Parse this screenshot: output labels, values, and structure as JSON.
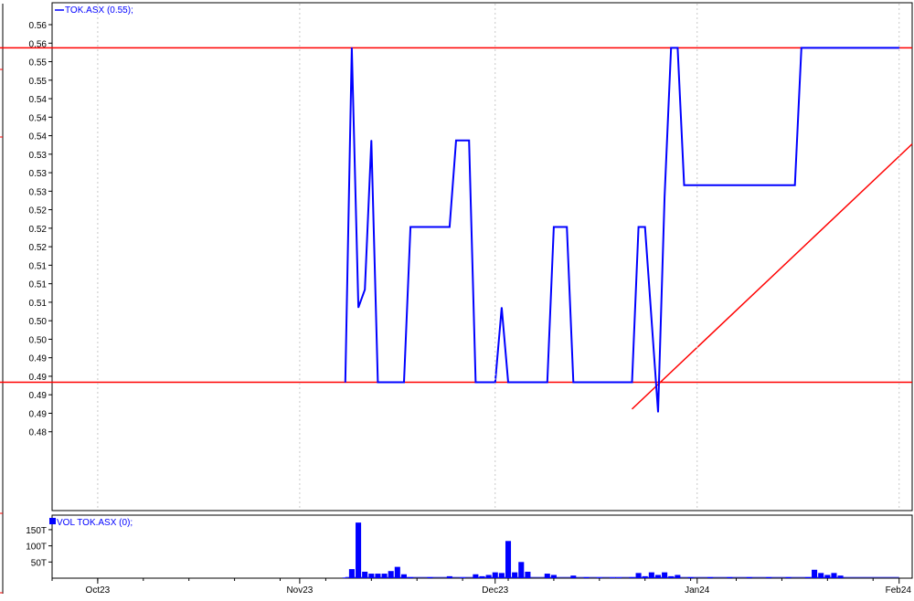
{
  "chart_data": [
    {
      "type": "line",
      "legend": "TOK.ASX (0.55);",
      "legend_position": "top-left",
      "y_tick_labels": [
        "0.56",
        "0.56",
        "0.55",
        "0.55",
        "0.54",
        "0.54",
        "0.54",
        "0.53",
        "0.53",
        "0.53",
        "0.52",
        "0.52",
        "0.52",
        "0.51",
        "0.51",
        "0.51",
        "0.50",
        "0.50",
        "0.49",
        "0.49",
        "0.49",
        "0.49",
        "0.48"
      ],
      "ylim": [
        0.4765,
        0.5614
      ],
      "x_tick_labels": [
        "Oct23",
        "Nov23",
        "Dec23",
        "Jan24",
        "Feb24"
      ],
      "x_tick_dates": [
        "2023-10-01",
        "2023-11-01",
        "2023-12-01",
        "2024-01-01",
        "2024-02-01"
      ],
      "xlim": [
        "2023-09-24",
        "2024-02-03"
      ],
      "series": [
        {
          "color": "#0000ff",
          "points": [
            [
              "2023-11-08",
              0.498
            ],
            [
              "2023-11-09",
              0.554
            ],
            [
              "2023-11-10",
              0.5105
            ],
            [
              "2023-11-11",
              0.5135
            ],
            [
              "2023-11-12",
              0.5385
            ],
            [
              "2023-11-13",
              0.498
            ],
            [
              "2023-11-17",
              0.498
            ],
            [
              "2023-11-18",
              0.524
            ],
            [
              "2023-11-24",
              0.524
            ],
            [
              "2023-11-25",
              0.5385
            ],
            [
              "2023-11-27",
              0.5385
            ],
            [
              "2023-11-28",
              0.498
            ],
            [
              "2023-12-01",
              0.498
            ],
            [
              "2023-12-02",
              0.5105
            ],
            [
              "2023-12-03",
              0.498
            ],
            [
              "2023-12-09",
              0.498
            ],
            [
              "2023-12-10",
              0.524
            ],
            [
              "2023-12-12",
              0.524
            ],
            [
              "2023-12-13",
              0.498
            ],
            [
              "2023-12-22",
              0.498
            ],
            [
              "2023-12-23",
              0.524
            ],
            [
              "2023-12-24",
              0.524
            ],
            [
              "2023-12-26",
              0.493
            ],
            [
              "2023-12-27",
              0.529
            ],
            [
              "2023-12-28",
              0.554
            ],
            [
              "2023-12-29",
              0.554
            ],
            [
              "2023-12-30",
              0.531
            ],
            [
              "2024-01-16",
              0.531
            ],
            [
              "2024-01-17",
              0.554
            ],
            [
              "2024-02-01",
              0.554
            ]
          ]
        }
      ],
      "horizontal_lines": [
        {
          "y": 0.554,
          "color": "#ff0000"
        },
        {
          "y": 0.498,
          "color": "#ff0000"
        }
      ],
      "trend_line": {
        "from": [
          "2023-12-22",
          0.4935
        ],
        "to": [
          "2024-02-03",
          0.5379
        ],
        "color": "#ff0000"
      }
    },
    {
      "type": "bar",
      "legend": "VOL TOK.ASX (0);",
      "legend_position": "top-left",
      "y_tick_labels": [
        "150T",
        "100T",
        "50T"
      ],
      "y_tick_values": [
        150000,
        100000,
        50000
      ],
      "ylim": [
        0,
        195000
      ],
      "color": "#0000ff",
      "bars": [
        [
          "2023-11-08",
          2000
        ],
        [
          "2023-11-09",
          28000
        ],
        [
          "2023-11-10",
          172000
        ],
        [
          "2023-11-11",
          20000
        ],
        [
          "2023-11-12",
          14000
        ],
        [
          "2023-11-13",
          14000
        ],
        [
          "2023-11-14",
          14000
        ],
        [
          "2023-11-15",
          22000
        ],
        [
          "2023-11-16",
          35000
        ],
        [
          "2023-11-17",
          12000
        ],
        [
          "2023-11-18",
          3000
        ],
        [
          "2023-11-21",
          3000
        ],
        [
          "2023-11-24",
          6000
        ],
        [
          "2023-11-26",
          2000
        ],
        [
          "2023-11-28",
          12000
        ],
        [
          "2023-11-29",
          6000
        ],
        [
          "2023-11-30",
          10000
        ],
        [
          "2023-12-01",
          18000
        ],
        [
          "2023-12-02",
          16000
        ],
        [
          "2023-12-03",
          115000
        ],
        [
          "2023-12-04",
          18000
        ],
        [
          "2023-12-05",
          50000
        ],
        [
          "2023-12-06",
          20000
        ],
        [
          "2023-12-09",
          14000
        ],
        [
          "2023-12-10",
          10000
        ],
        [
          "2023-12-13",
          8000
        ],
        [
          "2023-12-15",
          3000
        ],
        [
          "2023-12-17",
          2000
        ],
        [
          "2023-12-19",
          2000
        ],
        [
          "2023-12-20",
          2000
        ],
        [
          "2023-12-22",
          3000
        ],
        [
          "2023-12-23",
          16000
        ],
        [
          "2023-12-24",
          6000
        ],
        [
          "2023-12-25",
          18000
        ],
        [
          "2023-12-26",
          10000
        ],
        [
          "2023-12-27",
          18000
        ],
        [
          "2023-12-28",
          6000
        ],
        [
          "2023-12-29",
          10000
        ],
        [
          "2023-12-31",
          3000
        ],
        [
          "2024-01-03",
          3000
        ],
        [
          "2024-01-06",
          3000
        ],
        [
          "2024-01-09",
          3000
        ],
        [
          "2024-01-12",
          3000
        ],
        [
          "2024-01-15",
          3000
        ],
        [
          "2024-01-18",
          3000
        ],
        [
          "2024-01-19",
          26000
        ],
        [
          "2024-01-20",
          16000
        ],
        [
          "2024-01-21",
          10000
        ],
        [
          "2024-01-22",
          16000
        ],
        [
          "2024-01-23",
          8000
        ]
      ]
    }
  ]
}
